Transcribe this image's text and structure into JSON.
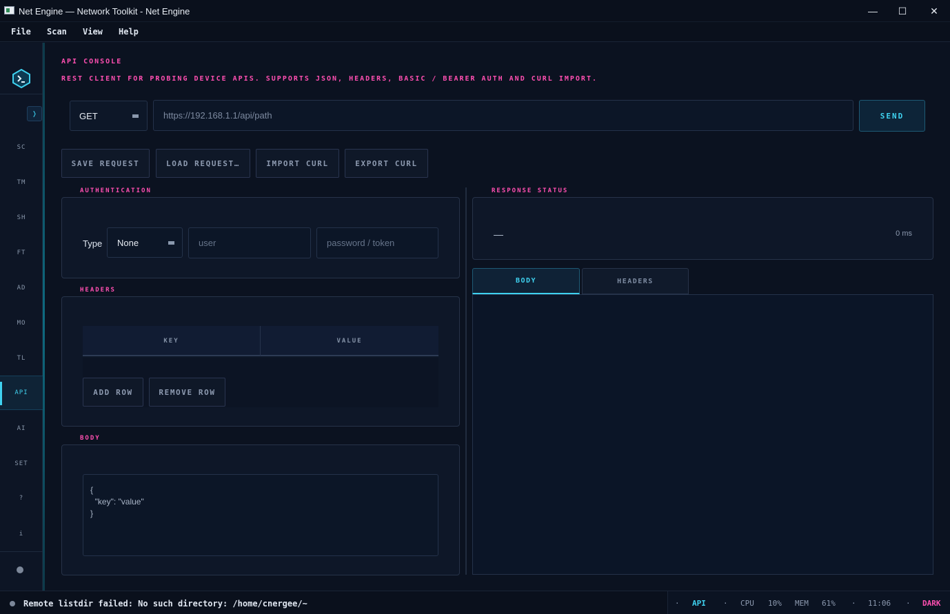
{
  "window": {
    "title": "Net Engine — Network Toolkit - Net Engine",
    "minimize_glyph": "—",
    "maximize_glyph": "☐",
    "close_glyph": "✕"
  },
  "menu": {
    "items": [
      "File",
      "Scan",
      "View",
      "Help"
    ]
  },
  "sidebar": {
    "collapse_glyph": "❭",
    "items": [
      {
        "label": "SC",
        "active": false
      },
      {
        "label": "TM",
        "active": false
      },
      {
        "label": "SH",
        "active": false
      },
      {
        "label": "FT",
        "active": false
      },
      {
        "label": "AD",
        "active": false
      },
      {
        "label": "MO",
        "active": false
      },
      {
        "label": "TL",
        "active": false
      },
      {
        "label": "API",
        "active": true
      },
      {
        "label": "AI",
        "active": false
      },
      {
        "label": "SET",
        "active": false
      },
      {
        "label": "?",
        "active": false
      },
      {
        "label": "i",
        "active": false
      }
    ],
    "accent_color": "#3fd2f0"
  },
  "page": {
    "title": "API CONSOLE",
    "subtitle": "REST CLIENT FOR PROBING DEVICE APIS. SUPPORTS JSON, HEADERS, BASIC / BEARER AUTH AND CURL IMPORT."
  },
  "request": {
    "method": "GET",
    "url_placeholder": "https://192.168.1.1/api/path",
    "send_label": "SEND"
  },
  "toolbar": {
    "save_label": "SAVE REQUEST",
    "load_label": "LOAD REQUEST…",
    "import_label": "IMPORT CURL",
    "export_label": "EXPORT CURL"
  },
  "auth": {
    "group_label": "AUTHENTICATION",
    "type_label": "Type",
    "type_value": "None",
    "user_placeholder": "user",
    "password_placeholder": "password / token"
  },
  "headers": {
    "group_label": "HEADERS",
    "columns": [
      "KEY",
      "VALUE"
    ],
    "add_label": "ADD ROW",
    "remove_label": "REMOVE ROW"
  },
  "body": {
    "group_label": "BODY",
    "lines": [
      "{",
      "  \"key\": \"value\"",
      "}"
    ]
  },
  "response": {
    "group_label": "RESPONSE STATUS",
    "status_code": "—",
    "time": "0 ms",
    "tabs": [
      {
        "label": "BODY",
        "active": true
      },
      {
        "label": "HEADERS",
        "active": false
      }
    ]
  },
  "statusbar": {
    "message": "Remote listdir failed: No such directory: /home/cnergee/~",
    "sep": "·",
    "module": "API",
    "cpu_label": "CPU",
    "cpu_value": "10%",
    "mem_label": "MEM",
    "mem_value": "61%",
    "clock": "11:06",
    "theme": "DARK"
  },
  "colors": {
    "accent_cyan": "#3fd2f0",
    "accent_pink": "#ff4fb1",
    "background": "#0b1220"
  }
}
